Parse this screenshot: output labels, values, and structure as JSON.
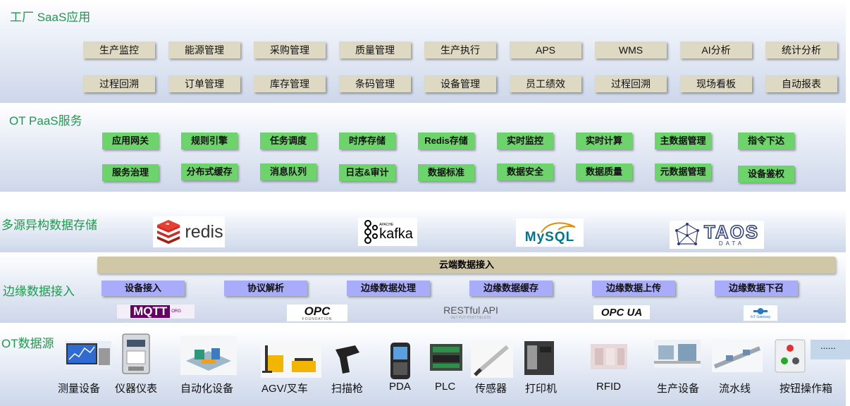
{
  "saas": {
    "title": "工厂 SaaS应用",
    "row1": [
      "生产监控",
      "能源管理",
      "采购管理",
      "质量管理",
      "生产执行",
      "APS",
      "WMS",
      "AI分析",
      "统计分析"
    ],
    "row2": [
      "过程回溯",
      "订单管理",
      "库存管理",
      "条码管理",
      "设备管理",
      "员工绩效",
      "过程回溯",
      "现场看板",
      "自动报表"
    ]
  },
  "paas": {
    "title": "OT  PaaS服务",
    "row1": [
      "应用网关",
      "规则引擎",
      "任务调度",
      "时序存储",
      "Redis存储",
      "实时监控",
      "实时计算",
      "主数据管理",
      "指令下达"
    ],
    "row2": [
      "服务治理",
      "分布式缓存",
      "消息队列",
      "日志&审计",
      "数据标准",
      "数据安全",
      "数据质量",
      "元数据管理",
      "设备鉴权"
    ]
  },
  "storage": {
    "title": "多源异构数据存储",
    "logos": {
      "redis": "redis",
      "kafka_small": "APACHE",
      "kafka": "kafka",
      "mysql": "MySQL",
      "taos": "TAOS",
      "taos_sub": "DATA"
    }
  },
  "edge": {
    "title": "边缘数据接入",
    "cloud": "云端数据接入",
    "items": [
      "设备接入",
      "协议解析",
      "边缘数据处理",
      "边缘数据缓存",
      "边缘数据上传",
      "边缘数据下召"
    ],
    "protocols": {
      "mqtt": "MQTT",
      "mqtt_sub": "ORG",
      "opc": "OPC",
      "opc_sub": "FOUNDATION",
      "rest": "RESTful API",
      "rest_sub": "GET PUT POST DELETE",
      "opcua": "OPC UA",
      "iot": "IoT Gateway"
    }
  },
  "ot": {
    "title": "OT数据源",
    "devices": [
      "测量设备",
      "仪器仪表",
      "自动化设备",
      "AGV/叉车",
      "扫描枪",
      "PDA",
      "PLC",
      "传感器",
      "打印机",
      "RFID",
      "生产设备",
      "流水线",
      "按钮操作箱"
    ],
    "more": "......"
  },
  "colors": {
    "title_green": "#1f9a4e",
    "saas_chip": "#ded9c2",
    "paas_chip": "#6cd46a",
    "edge_chip": "#a9abfb",
    "cloud_bar": "#cfc7a6"
  }
}
